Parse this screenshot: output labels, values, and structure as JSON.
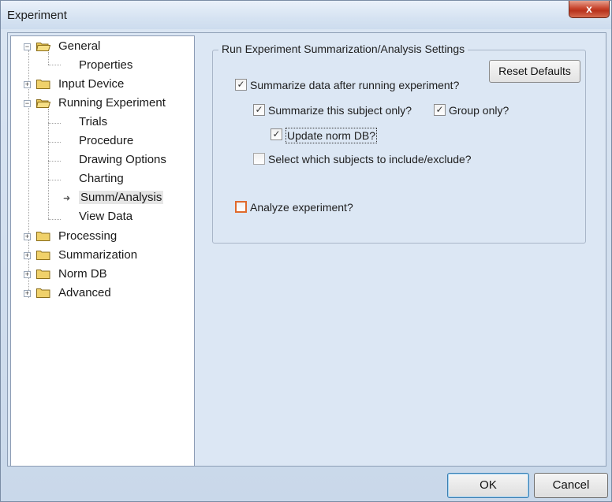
{
  "window": {
    "title": "Experiment",
    "close_label": "x"
  },
  "tree": {
    "nodes": [
      {
        "label": "General",
        "expander": "−"
      },
      {
        "label": "Properties"
      },
      {
        "label": "Input Device",
        "expander": "+"
      },
      {
        "label": "Running Experiment",
        "expander": "−"
      },
      {
        "label": "Trials"
      },
      {
        "label": "Procedure"
      },
      {
        "label": "Drawing Options"
      },
      {
        "label": "Charting"
      },
      {
        "label": "Summ/Analysis"
      },
      {
        "label": "View Data"
      },
      {
        "label": "Processing",
        "expander": "+"
      },
      {
        "label": "Summarization",
        "expander": "+"
      },
      {
        "label": "Norm DB",
        "expander": "+"
      },
      {
        "label": "Advanced",
        "expander": "+"
      }
    ],
    "selected": "Summ/Analysis"
  },
  "settings": {
    "group_title": "Run Experiment Summarization/Analysis Settings",
    "reset_label": "Reset Defaults",
    "checkboxes": {
      "summarize_after_run": {
        "label": "Summarize data after running experiment?",
        "checked": true
      },
      "summarize_subject_only": {
        "label": "Summarize this subject only?",
        "checked": true
      },
      "group_only": {
        "label": "Group only?",
        "checked": true
      },
      "update_norm_db": {
        "label": "Update norm DB?",
        "checked": true
      },
      "select_subjects": {
        "label": "Select which subjects to include/exclude?",
        "checked": false
      },
      "analyze_experiment": {
        "label": "Analyze experiment?",
        "checked": false
      }
    }
  },
  "footer": {
    "ok_label": "OK",
    "cancel_label": "Cancel"
  },
  "colors": {
    "accent_focus": "#e06a2c",
    "panel_bg": "#dce7f4",
    "close_red": "#c8452d"
  }
}
